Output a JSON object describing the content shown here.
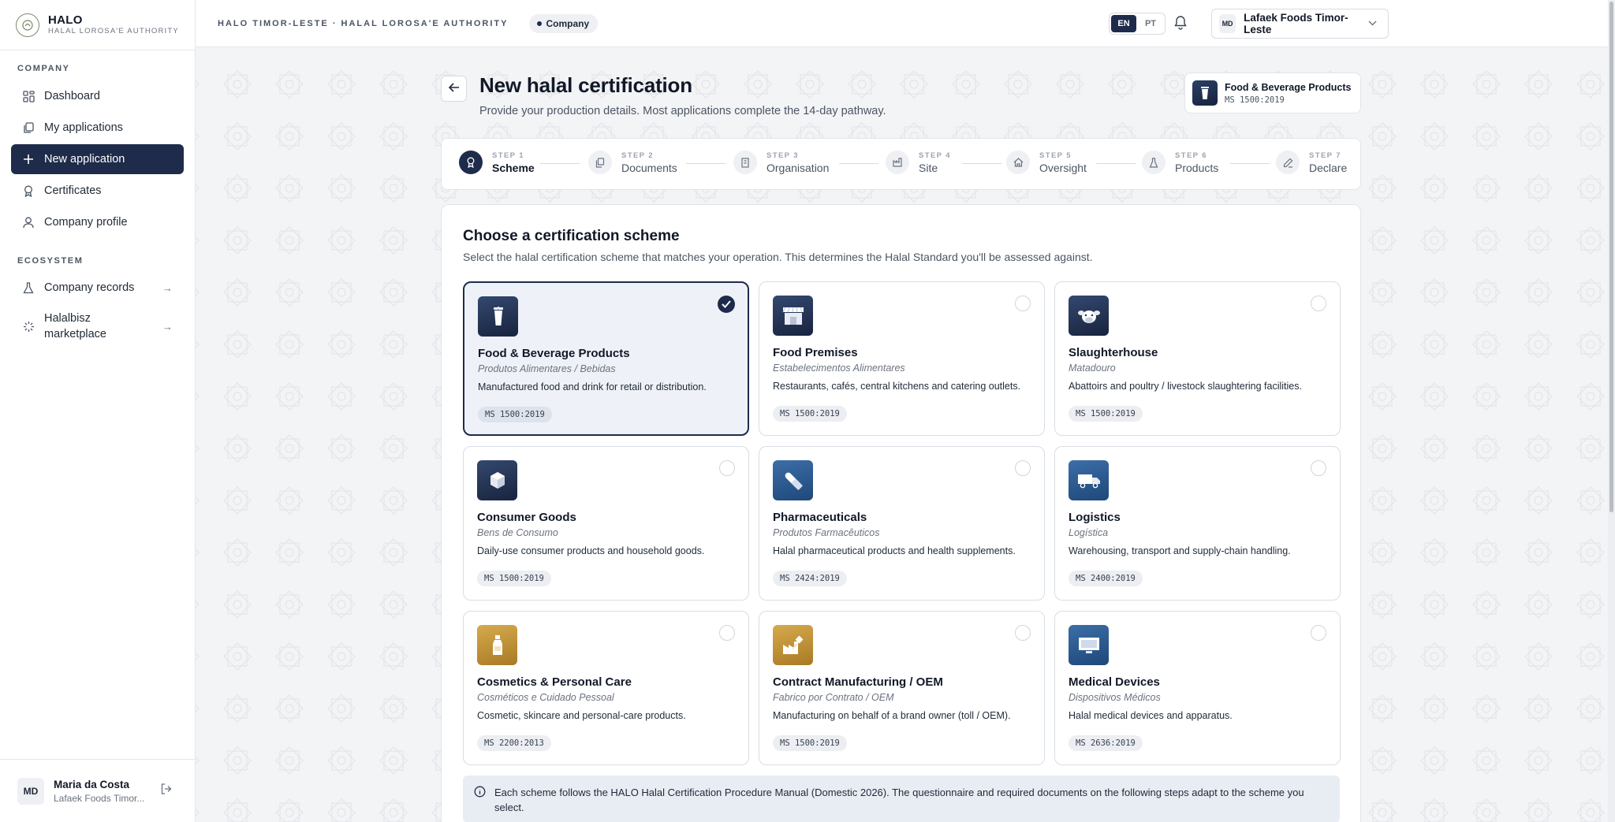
{
  "brand": {
    "name": "HALO",
    "subtitle": "HALAL LOROSA'E AUTHORITY"
  },
  "sidebar": {
    "section_company": "COMPANY",
    "section_ecosystem": "ECOSYSTEM",
    "items": [
      {
        "label": "Dashboard",
        "icon": "grid-icon"
      },
      {
        "label": "My applications",
        "icon": "copy-icon"
      },
      {
        "label": "New application",
        "icon": "plus-icon",
        "active": true
      },
      {
        "label": "Certificates",
        "icon": "award-icon"
      },
      {
        "label": "Company profile",
        "icon": "user-icon"
      }
    ],
    "eco_items": [
      {
        "label": "Company records",
        "icon": "flask-icon"
      },
      {
        "label": "Halalbisz marketplace",
        "icon": "loader-icon"
      }
    ],
    "user": {
      "initials": "MD",
      "name": "Maria da Costa",
      "org": "Lafaek Foods Timor..."
    }
  },
  "topbar": {
    "breadcrumb": "HALO TIMOR-LESTE · HALAL LOROSA'E AUTHORITY",
    "role": "Company",
    "lang_en": "EN",
    "lang_pt": "PT",
    "org_initials": "MD",
    "org_name": "Lafaek Foods Timor-Leste"
  },
  "header": {
    "title": "New halal certification",
    "subtitle": "Provide your production details. Most applications complete the 14-day pathway.",
    "selected_name": "Food & Beverage Products",
    "selected_code": "MS 1500:2019"
  },
  "steps": [
    {
      "num": "STEP 1",
      "name": "Scheme"
    },
    {
      "num": "STEP 2",
      "name": "Documents"
    },
    {
      "num": "STEP 3",
      "name": "Organisation"
    },
    {
      "num": "STEP 4",
      "name": "Site"
    },
    {
      "num": "STEP 5",
      "name": "Oversight"
    },
    {
      "num": "STEP 6",
      "name": "Products"
    },
    {
      "num": "STEP 7",
      "name": "Declare"
    }
  ],
  "panel": {
    "title": "Choose a certification scheme",
    "subtitle": "Select the halal certification scheme that matches your operation. This determines the Halal Standard you'll be assessed against."
  },
  "schemes": [
    {
      "name": "Food & Beverage Products",
      "alt": "Produtos Alimentares / Bebidas",
      "desc": "Manufactured food and drink for retail or distribution.",
      "code": "MS 1500:2019",
      "icon": "cup-icon",
      "color": "#1e2b4a",
      "selected": true
    },
    {
      "name": "Food Premises",
      "alt": "Estabelecimentos Alimentares",
      "desc": "Restaurants, cafés, central kitchens and catering outlets.",
      "code": "MS 1500:2019",
      "icon": "store-icon",
      "color": "#1e2b4a"
    },
    {
      "name": "Slaughterhouse",
      "alt": "Matadouro",
      "desc": "Abattoirs and poultry / livestock slaughtering facilities.",
      "code": "MS 1500:2019",
      "icon": "animal-icon",
      "color": "#1e2b4a"
    },
    {
      "name": "Consumer Goods",
      "alt": "Bens de Consumo",
      "desc": "Daily-use consumer products and household goods.",
      "code": "MS 1500:2019",
      "icon": "box-icon",
      "color": "#1e2b4a"
    },
    {
      "name": "Pharmaceuticals",
      "alt": "Produtos Farmacêuticos",
      "desc": "Halal pharmaceutical products and health supplements.",
      "code": "MS 2424:2019",
      "icon": "pill-icon",
      "color": "#2b5c94"
    },
    {
      "name": "Logistics",
      "alt": "Logística",
      "desc": "Warehousing, transport and supply-chain handling.",
      "code": "MS 2400:2019",
      "icon": "truck-icon",
      "color": "#2b5c94"
    },
    {
      "name": "Cosmetics & Personal Care",
      "alt": "Cosméticos e Cuidado Pessoal",
      "desc": "Cosmetic, skincare and personal-care products.",
      "code": "MS 2200:2013",
      "icon": "bottle-icon",
      "color": "#c1913a"
    },
    {
      "name": "Contract Manufacturing / OEM",
      "alt": "Fabrico por Contrato / OEM",
      "desc": "Manufacturing on behalf of a brand owner (toll / OEM).",
      "code": "MS 1500:2019",
      "icon": "factory-icon",
      "color": "#c1913a"
    },
    {
      "name": "Medical Devices",
      "alt": "Dispositivos Médicos",
      "desc": "Halal medical devices and apparatus.",
      "code": "MS 2636:2019",
      "icon": "monitor-icon",
      "color": "#2b5c94"
    }
  ],
  "info": "Each scheme follows the HALO Halal Certification Procedure Manual (Domestic 2026). The questionnaire and required documents on the following steps adapt to the scheme you select."
}
